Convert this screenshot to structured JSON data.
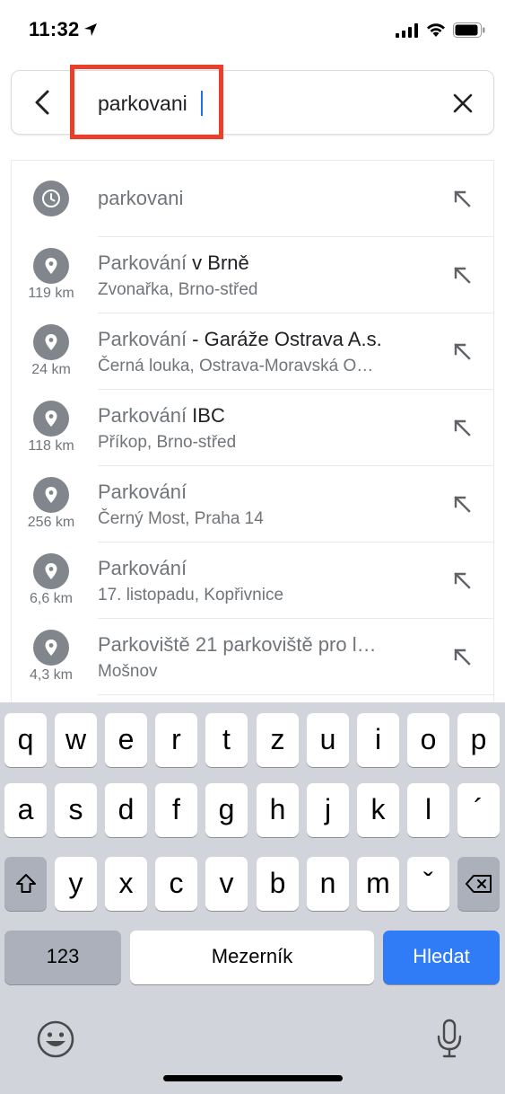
{
  "status_bar": {
    "time": "11:32"
  },
  "search": {
    "query": "parkovani",
    "back_icon": "chevron-left-icon",
    "clear_icon": "close-icon",
    "highlight_color": "#e8402a"
  },
  "suggestions": [
    {
      "type": "history",
      "icon": "clock-icon",
      "title_match": "",
      "title_rest": "parkovani",
      "distance": "",
      "subtitle": ""
    },
    {
      "type": "place",
      "icon": "place-pin-icon",
      "title_match": "Parkování",
      "title_rest": " v Brně",
      "distance": "119 km",
      "subtitle": "Zvonařka, Brno-střed"
    },
    {
      "type": "place",
      "icon": "place-pin-icon",
      "title_match": "Parkování",
      "title_rest": " - Garáže Ostrava A.s.",
      "distance": "24 km",
      "subtitle": "Černá louka, Ostrava-Moravská O…"
    },
    {
      "type": "place",
      "icon": "place-pin-icon",
      "title_match": "Parkování",
      "title_rest": " IBC",
      "distance": "118 km",
      "subtitle": "Příkop, Brno-střed"
    },
    {
      "type": "place",
      "icon": "place-pin-icon",
      "title_match": "Parkování",
      "title_rest": "",
      "distance": "256 km",
      "subtitle": "Černý Most, Praha 14"
    },
    {
      "type": "place",
      "icon": "place-pin-icon",
      "title_match": "Parkování",
      "title_rest": "",
      "distance": "6,6 km",
      "subtitle": "17. listopadu, Kopřivnice"
    },
    {
      "type": "place",
      "icon": "place-pin-icon",
      "title_match": "Parkoviště",
      "title_rest": " 21 parkoviště pro l…",
      "distance": "4,3 km",
      "subtitle": "Mošnov"
    }
  ],
  "keyboard": {
    "row1": [
      "q",
      "w",
      "e",
      "r",
      "t",
      "z",
      "u",
      "i",
      "o",
      "p"
    ],
    "row2": [
      "a",
      "s",
      "d",
      "f",
      "g",
      "h",
      "j",
      "k",
      "l",
      "´"
    ],
    "row3": [
      "y",
      "x",
      "c",
      "v",
      "b",
      "n",
      "m",
      "ˇ"
    ],
    "numbers_label": "123",
    "space_label": "Mezerník",
    "search_label": "Hledat",
    "search_key_color": "#2f7cf6"
  }
}
